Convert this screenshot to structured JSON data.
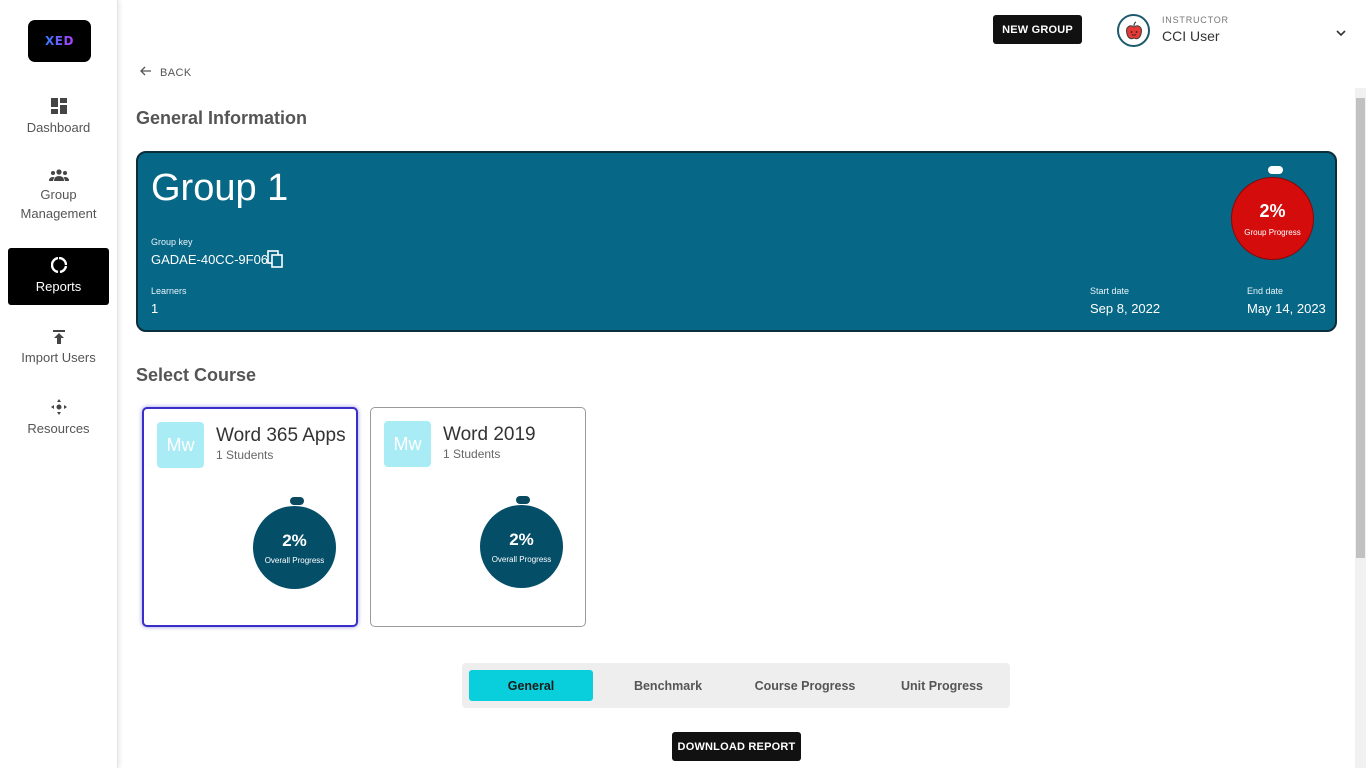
{
  "brand": {
    "logo_text": "XED"
  },
  "sidebar": {
    "items": [
      {
        "label": "Dashboard",
        "icon": "dashboard-icon",
        "active": false
      },
      {
        "label": "Group Management",
        "icon": "group-icon",
        "active": false
      },
      {
        "label": "Reports",
        "icon": "reports-icon",
        "active": true
      },
      {
        "label": "Import Users",
        "icon": "upload-icon",
        "active": false
      },
      {
        "label": "Resources",
        "icon": "resources-icon",
        "active": false
      }
    ]
  },
  "header": {
    "new_group_label": "NEW GROUP",
    "role": "INSTRUCTOR",
    "user_name": "CCI User"
  },
  "back_label": "BACK",
  "general": {
    "section_title": "General Information",
    "group_name": "Group 1",
    "group_key_label": "Group key",
    "group_key": "GADAE-40CC-9F06",
    "learners_label": "Learners",
    "learners": "1",
    "start_label": "Start date",
    "start_date": "Sep 8, 2022",
    "end_label": "End date",
    "end_date": "May 14, 2023",
    "progress_pct": "2%",
    "progress_label": "Group Progress"
  },
  "courses": {
    "section_title": "Select Course",
    "items": [
      {
        "abbr": "Mw",
        "name": "Word 365 Apps",
        "students": "1 Students",
        "progress_pct": "2%",
        "progress_label": "Overall Progress",
        "selected": true
      },
      {
        "abbr": "Mw",
        "name": "Word 2019",
        "students": "1 Students",
        "progress_pct": "2%",
        "progress_label": "Overall Progress",
        "selected": false
      }
    ]
  },
  "tabs": {
    "items": [
      "General",
      "Benchmark",
      "Course Progress",
      "Unit Progress"
    ],
    "active": "General"
  },
  "download_label": "DOWNLOAD REPORT",
  "colors": {
    "group_card": "#066787",
    "group_progress": "#d40c0c",
    "course_progress": "#044e68",
    "active_tab": "#09cfdc",
    "selected_border": "#3a2ec9"
  }
}
